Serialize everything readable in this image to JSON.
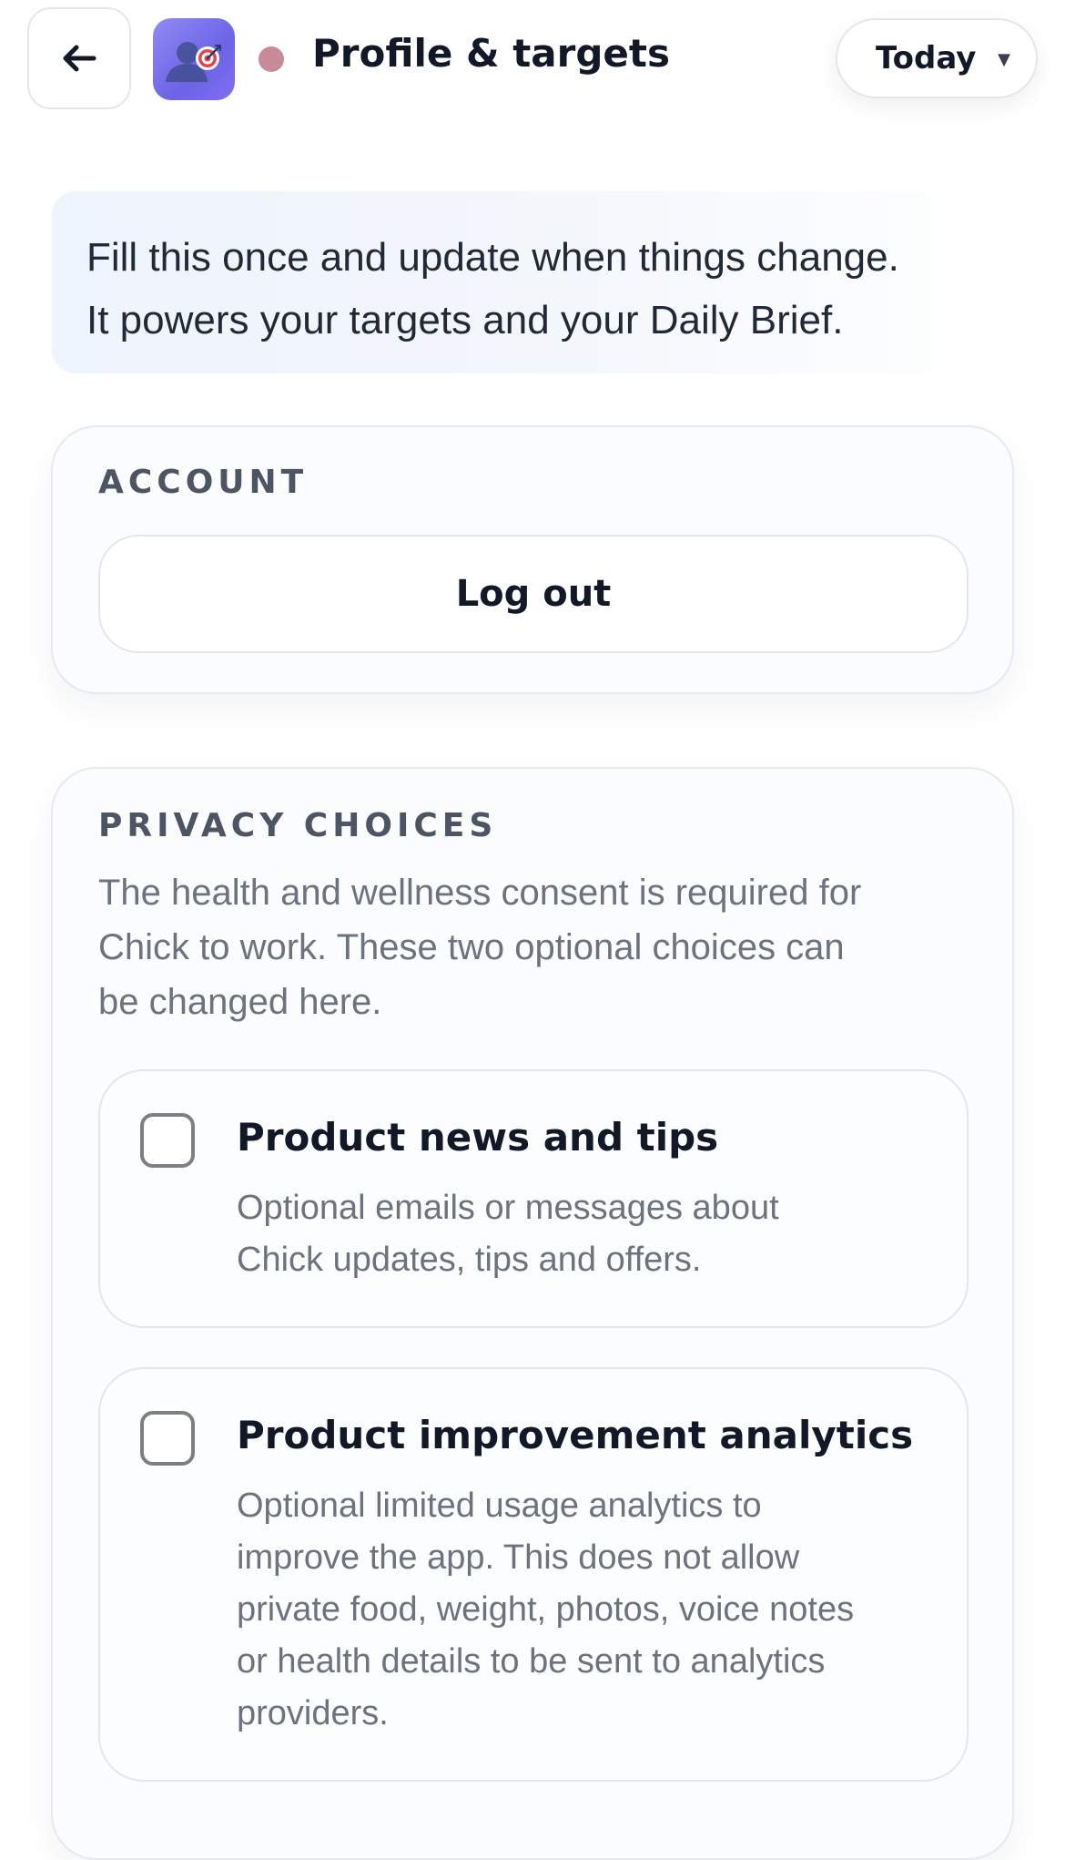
{
  "header": {
    "title": "Profile & targets",
    "date_select": {
      "selected": "Today"
    },
    "status_dot_color": "#c98a98"
  },
  "intro": {
    "lines": [
      "Fill this once and update when things change.",
      "It powers your targets and your Daily Brief."
    ]
  },
  "account": {
    "label": "ACCOUNT",
    "logout_label": "Log out"
  },
  "privacy": {
    "label": "PRIVACY CHOICES",
    "description_lines": [
      "The health and wellness consent is required for",
      "Chick to work. These two optional choices can",
      "be changed here."
    ],
    "options": [
      {
        "title": "Product news and tips",
        "checked": false,
        "description_lines": [
          "Optional emails or messages about",
          "Chick updates, tips and offers."
        ]
      },
      {
        "title": "Product improvement analytics",
        "checked": false,
        "description_lines": [
          "Optional limited usage analytics to",
          "improve the app. This does not allow",
          "private food, weight, photos, voice notes",
          "or health details to be sent to analytics",
          "providers."
        ]
      }
    ]
  },
  "icons": {
    "back": "arrow-left-icon",
    "app": "profile-target-icon",
    "dropdown": "chevron-down-icon"
  }
}
